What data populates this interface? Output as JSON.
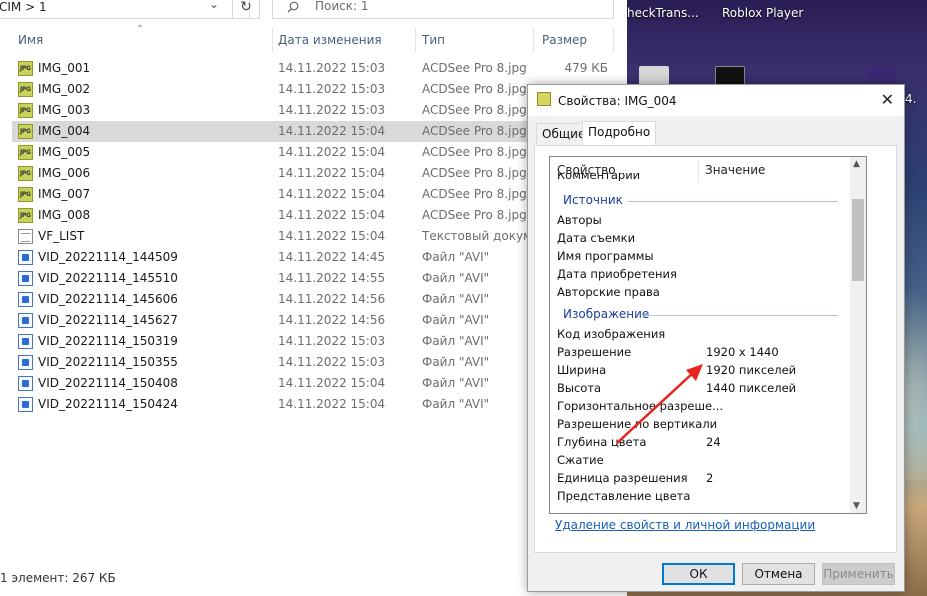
{
  "explorer": {
    "address_path": "CIM  >  1",
    "search_placeholder": "Поиск: 1",
    "columns": {
      "name": "Имя",
      "date": "Дата изменения",
      "type": "Тип",
      "size": "Размер"
    },
    "files": [
      {
        "name": "IMG_001",
        "date": "14.11.2022 15:03",
        "type": "ACDSee Pro 8.jpg ...",
        "size": "479 КБ",
        "icon": "jpg-file-icon",
        "selected": false
      },
      {
        "name": "IMG_002",
        "date": "14.11.2022 15:03",
        "type": "ACDSee Pro 8.jpg ...",
        "size": "",
        "icon": "jpg-file-icon",
        "selected": false
      },
      {
        "name": "IMG_003",
        "date": "14.11.2022 15:03",
        "type": "ACDSee Pro 8.jpg ...",
        "size": "",
        "icon": "jpg-file-icon",
        "selected": false
      },
      {
        "name": "IMG_004",
        "date": "14.11.2022 15:04",
        "type": "ACDSee Pro 8.jpg ...",
        "size": "",
        "icon": "jpg-file-icon",
        "selected": true
      },
      {
        "name": "IMG_005",
        "date": "14.11.2022 15:04",
        "type": "ACDSee Pro 8.jpg ...",
        "size": "",
        "icon": "jpg-file-icon",
        "selected": false
      },
      {
        "name": "IMG_006",
        "date": "14.11.2022 15:04",
        "type": "ACDSee Pro 8.jpg ...",
        "size": "",
        "icon": "jpg-file-icon",
        "selected": false
      },
      {
        "name": "IMG_007",
        "date": "14.11.2022 15:04",
        "type": "ACDSee Pro 8.jpg ...",
        "size": "",
        "icon": "jpg-file-icon",
        "selected": false
      },
      {
        "name": "IMG_008",
        "date": "14.11.2022 15:04",
        "type": "ACDSee Pro 8.jpg ...",
        "size": "",
        "icon": "jpg-file-icon",
        "selected": false
      },
      {
        "name": "VF_LIST",
        "date": "14.11.2022 15:04",
        "type": "Текстовый докум...",
        "size": "",
        "icon": "text-file-icon",
        "selected": false
      },
      {
        "name": "VID_20221114_144509",
        "date": "14.11.2022 14:45",
        "type": "Файл \"AVI\"",
        "size": "",
        "icon": "avi-file-icon",
        "selected": false
      },
      {
        "name": "VID_20221114_145510",
        "date": "14.11.2022 14:55",
        "type": "Файл \"AVI\"",
        "size": "",
        "icon": "avi-file-icon",
        "selected": false
      },
      {
        "name": "VID_20221114_145606",
        "date": "14.11.2022 14:56",
        "type": "Файл \"AVI\"",
        "size": "",
        "icon": "avi-file-icon",
        "selected": false
      },
      {
        "name": "VID_20221114_145627",
        "date": "14.11.2022 14:56",
        "type": "Файл \"AVI\"",
        "size": "",
        "icon": "avi-file-icon",
        "selected": false
      },
      {
        "name": "VID_20221114_150319",
        "date": "14.11.2022 15:03",
        "type": "Файл \"AVI\"",
        "size": "",
        "icon": "avi-file-icon",
        "selected": false
      },
      {
        "name": "VID_20221114_150355",
        "date": "14.11.2022 15:03",
        "type": "Файл \"AVI\"",
        "size": "",
        "icon": "avi-file-icon",
        "selected": false
      },
      {
        "name": "VID_20221114_150408",
        "date": "14.11.2022 15:04",
        "type": "Файл \"AVI\"",
        "size": "",
        "icon": "avi-file-icon",
        "selected": false
      },
      {
        "name": "VID_20221114_150424",
        "date": "14.11.2022 15:04",
        "type": "Файл \"AVI\"",
        "size": "",
        "icon": "avi-file-icon",
        "selected": false
      }
    ],
    "status": "1 элемент: 267 КБ"
  },
  "desktop": {
    "labels": [
      "heckTrans...",
      "Roblox Player",
      "4."
    ]
  },
  "dialog": {
    "title": "Свойства: IMG_004",
    "tabs": [
      "Общие",
      "Подробно"
    ],
    "active_tab": "Подробно",
    "list_header": {
      "name": "Свойство",
      "value": "Значение"
    },
    "partial_top": "Комментарии",
    "groups": [
      {
        "title": "Источник",
        "props": [
          {
            "name": "Авторы",
            "value": ""
          },
          {
            "name": "Дата съемки",
            "value": ""
          },
          {
            "name": "Имя программы",
            "value": ""
          },
          {
            "name": "Дата приобретения",
            "value": ""
          },
          {
            "name": "Авторские права",
            "value": ""
          }
        ]
      },
      {
        "title": "Изображение",
        "props": [
          {
            "name": "Код изображения",
            "value": ""
          },
          {
            "name": "Разрешение",
            "value": "1920 x 1440"
          },
          {
            "name": "Ширина",
            "value": "1920 пикселей"
          },
          {
            "name": "Высота",
            "value": "1440 пикселей"
          },
          {
            "name": "Горизонтальное разреше...",
            "value": ""
          },
          {
            "name": "Разрешение по вертикали",
            "value": ""
          },
          {
            "name": "Глубина цвета",
            "value": "24"
          },
          {
            "name": "Сжатие",
            "value": ""
          },
          {
            "name": "Единица разрешения",
            "value": "2"
          },
          {
            "name": "Представление цвета",
            "value": ""
          }
        ]
      }
    ],
    "remove_link": "Удаление свойств и личной информации",
    "buttons": {
      "ok": "ОК",
      "cancel": "Отмена",
      "apply": "Применить"
    },
    "annotation_arrow_color": "#e8261f"
  }
}
